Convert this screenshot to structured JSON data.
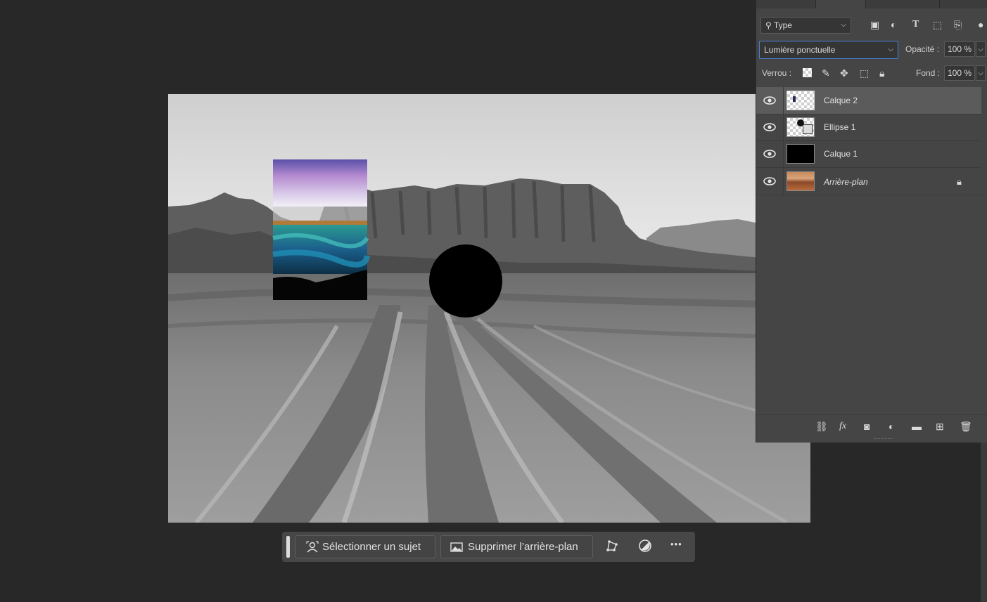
{
  "layers_panel": {
    "filter": {
      "label": "Type"
    },
    "blend_mode": {
      "value": "Lumière ponctuelle"
    },
    "opacity": {
      "label": "Opacité :",
      "value": "100 %"
    },
    "lock": {
      "label": "Verrou :"
    },
    "fill": {
      "label": "Fond :",
      "value": "100 %"
    },
    "layers": [
      {
        "name": "Calque 2",
        "thumb": "transparent-with-mark",
        "selected": true,
        "visible": true
      },
      {
        "name": "Ellipse 1",
        "thumb": "shape-layer",
        "selected": false,
        "visible": true
      },
      {
        "name": "Calque 1",
        "thumb": "black",
        "selected": false,
        "visible": true
      },
      {
        "name": "Arrière-plan",
        "thumb": "photo",
        "selected": false,
        "visible": true,
        "locked": true,
        "italic": true
      }
    ],
    "filter_icons": [
      "image-filter-icon",
      "adjustment-filter-icon",
      "type-filter-icon",
      "shape-filter-icon",
      "smart-object-filter-icon"
    ],
    "lock_icons": [
      "lock-transparent-pixels-icon",
      "lock-image-pixels-icon",
      "lock-position-icon",
      "lock-artboard-icon",
      "lock-all-icon"
    ],
    "bottom_icons": [
      "link-layers-icon",
      "fx-icon",
      "add-mask-icon",
      "adjustment-layer-icon",
      "new-group-icon",
      "new-layer-icon",
      "trash-icon"
    ]
  },
  "taskbar": {
    "select_subject": "Sélectionner un sujet",
    "remove_background": "Supprimer l’arrière-plan",
    "more": "•••"
  },
  "colors": {
    "app_bg": "#282828",
    "panel_bg": "#454545",
    "selected_layer": "#5b5b5b",
    "focus_border": "#4a7fd6"
  }
}
